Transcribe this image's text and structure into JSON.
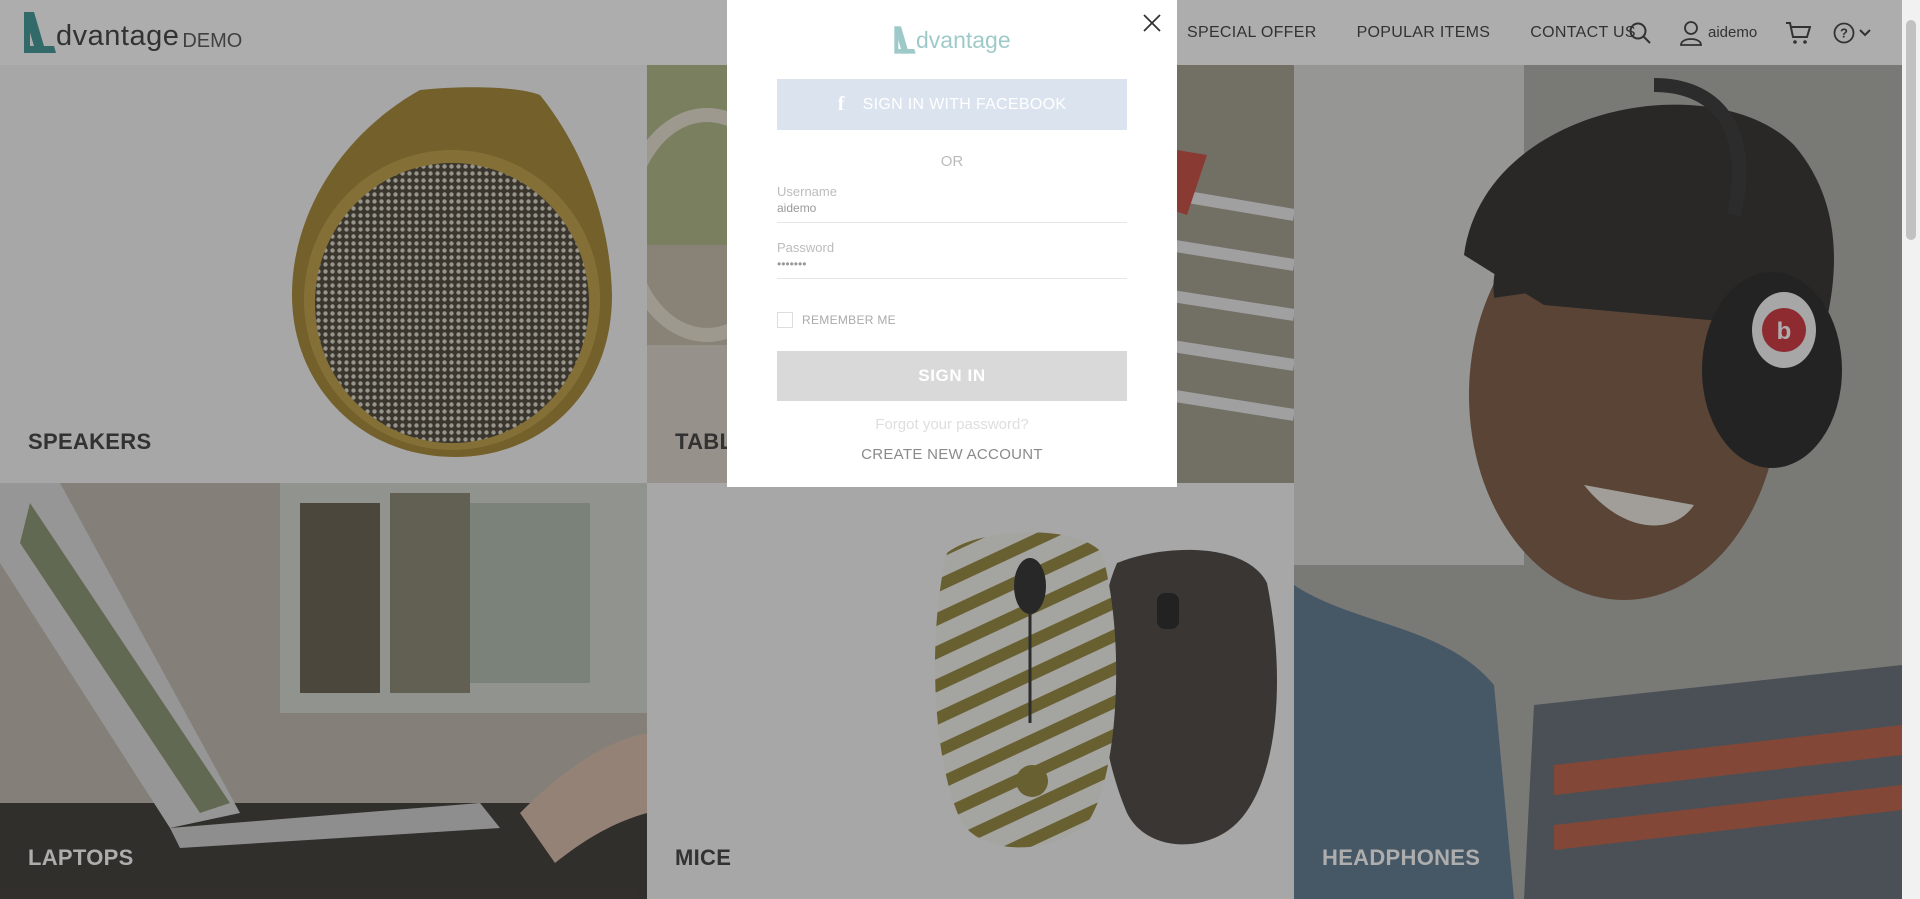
{
  "header": {
    "logo_word": "dvantage",
    "logo_suffix": "DEMO",
    "nav": [
      "SPECIAL OFFER",
      "POPULAR ITEMS",
      "CONTACT US"
    ],
    "user_name": "aidemo"
  },
  "categories": {
    "speakers": "SPEAKERS",
    "tablets": "TABL",
    "laptops": "LAPTOPS",
    "mice": "MICE",
    "headphones": "HEADPHONES"
  },
  "modal": {
    "logo_word": "dvantage",
    "facebook_label": "SIGN IN WITH FACEBOOK",
    "facebook_icon": "f",
    "or_label": "OR",
    "username_label": "Username",
    "username_value": "aidemo",
    "password_label": "Password",
    "password_value": "•••••••",
    "remember_label": "REMEMBER ME",
    "signin_label": "SIGN IN",
    "forgot_label": "Forgot your password?",
    "create_label": "CREATE NEW ACCOUNT"
  },
  "colors": {
    "accent": "#2b8a8a",
    "facebook": "#dbe3ef",
    "overlay": "rgba(60,60,60,0.42)"
  },
  "icons": [
    "search-icon",
    "user-icon",
    "cart-icon",
    "help-icon",
    "chevron-down-icon",
    "close-icon",
    "facebook-icon"
  ]
}
